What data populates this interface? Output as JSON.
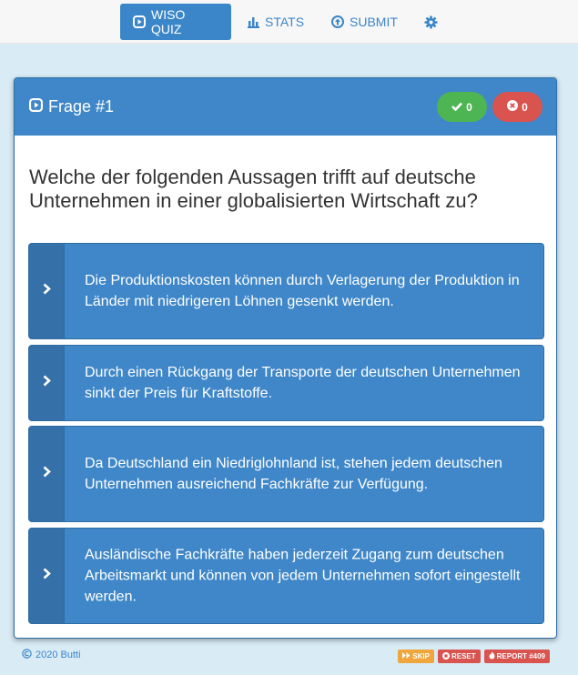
{
  "nav": {
    "quiz_label": "WISO QUIZ",
    "stats_label": "STATS",
    "submit_label": "SUBMIT"
  },
  "card": {
    "title": "Frage #1",
    "correct_count": "0",
    "wrong_count": "0"
  },
  "question": "Welche der folgenden Aussagen trifft auf deutsche Unternehmen in einer globalisierten Wirtschaft zu?",
  "answers": [
    "Die Produktionskosten können durch Verlagerung der Produktion in Länder mit niedrigeren Löhnen gesenkt werden.",
    "Durch einen Rückgang der Transporte der deutschen Unternehmen sinkt der Preis für Kraftstoffe.",
    "Da Deutschland ein Niedriglohnland ist, stehen jedem deutschen Unternehmen ausreichend Fachkräfte zur Verfügung.",
    "Ausländische Fachkräfte haben jederzeit Zugang zum deutschen Arbeitsmarkt und können von jedem Unternehmen sofort eingestellt werden."
  ],
  "footer": {
    "copyright": "2020 Butti",
    "skip_label": "SKIP",
    "reset_label": "RESET",
    "report_label": "REPORT #409"
  },
  "colors": {
    "primary": "#3f87c8",
    "success": "#4eb553",
    "danger": "#d9534f",
    "warning": "#efa73d",
    "background": "#d9ebf5"
  },
  "icons": {
    "quiz": "play-square-icon",
    "stats": "bar-chart-icon",
    "submit": "upload-circle-icon",
    "settings": "gear-icon",
    "answer": "chevron-right-icon"
  }
}
